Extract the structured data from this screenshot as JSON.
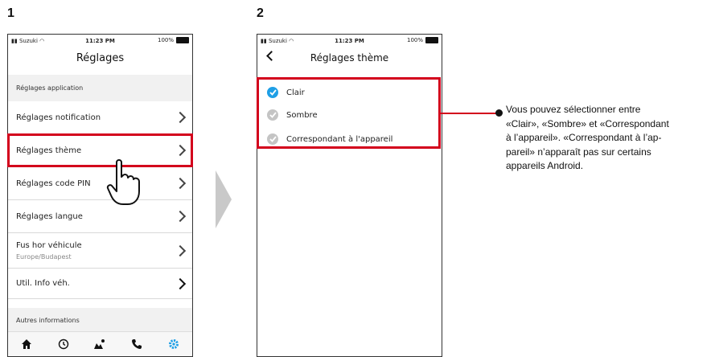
{
  "steps": [
    "1",
    "2"
  ],
  "screen1": {
    "status": {
      "carrier": "Suzuki",
      "time": "11:23 PM",
      "battery": "100%"
    },
    "title": "Réglages",
    "section_app": "Réglages application",
    "rows": [
      {
        "label": "Réglages notification"
      },
      {
        "label": "Réglages thème"
      },
      {
        "label": "Réglages code PIN"
      },
      {
        "label": "Réglages langue"
      },
      {
        "label": "Fus hor véhicule",
        "sub": "Europe/Budapest"
      },
      {
        "label": "Util. Info véh."
      }
    ],
    "section_other": "Autres informations",
    "tabs": [
      "home-icon",
      "history-icon",
      "map-icon",
      "phone-icon",
      "settings-icon"
    ],
    "active_tab_color": "#1e9fe6"
  },
  "screen2": {
    "status": {
      "carrier": "Suzuki",
      "time": "11:23 PM",
      "battery": "100%"
    },
    "title": "Réglages thème",
    "options": [
      {
        "label": "Clair",
        "selected": true
      },
      {
        "label": "Sombre",
        "selected": false
      },
      {
        "label": "Correspondant à l'appareil",
        "selected": false
      }
    ]
  },
  "callout": {
    "line1": "Vous pouvez sélectionner entre",
    "line2": "«Clair», «Sombre» et «Correspondant",
    "line3": "à l’appareil». «Correspondant à l’ap-",
    "line4": "pareil» n’apparaît pas sur certains",
    "line5": "appareils Android."
  },
  "colors": {
    "highlight": "#d3001c",
    "accent": "#1e9fe6"
  }
}
